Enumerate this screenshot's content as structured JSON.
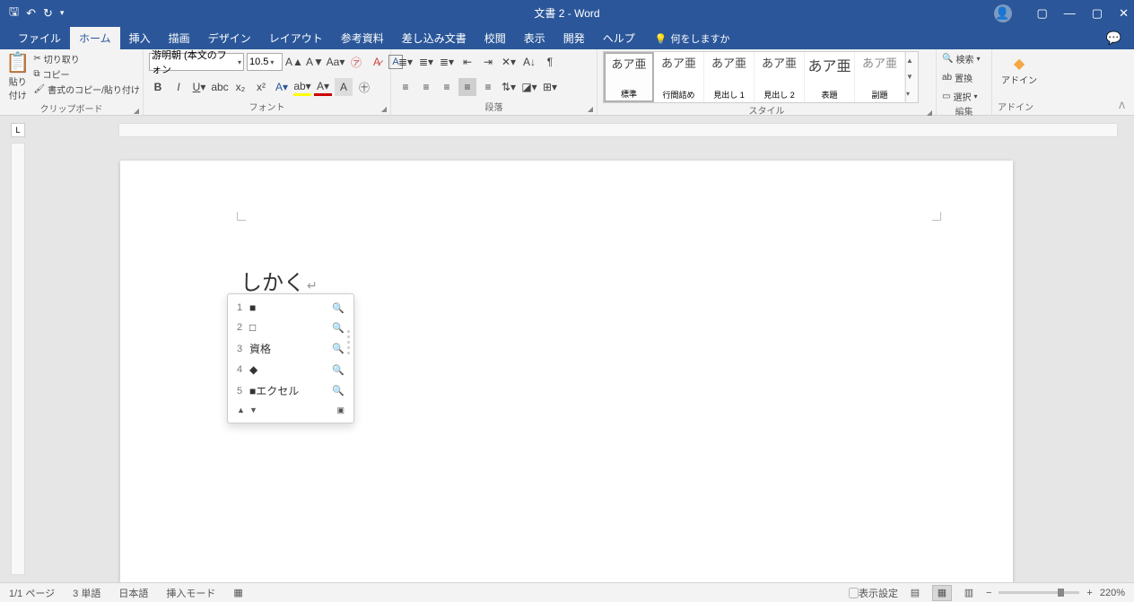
{
  "title": "文書 2 - Word",
  "tabs": {
    "file": "ファイル",
    "home": "ホーム",
    "insert": "挿入",
    "draw": "描画",
    "design": "デザイン",
    "layout": "レイアウト",
    "references": "参考資料",
    "mailings": "差し込み文書",
    "review": "校閲",
    "view": "表示",
    "developer": "開発",
    "help": "ヘルプ",
    "tell": "何をしますか"
  },
  "clipboard": {
    "paste": "貼り付け",
    "cut": "切り取り",
    "copy": "コピー",
    "format_painter": "書式のコピー/貼り付け",
    "label": "クリップボード"
  },
  "font": {
    "name": "游明朝 (本文のフォン",
    "size": "10.5",
    "label": "フォント"
  },
  "paragraph": {
    "label": "段落"
  },
  "styles": {
    "label": "スタイル",
    "preview": "あア亜",
    "items": [
      "標準",
      "行間詰め",
      "見出し 1",
      "見出し 2",
      "表題",
      "副題"
    ]
  },
  "editing": {
    "find": "検索",
    "replace": "置換",
    "select": "選択",
    "label": "編集"
  },
  "addins": {
    "label": "アドイン",
    "btn": "アドイン"
  },
  "document": {
    "text": "しかく"
  },
  "ime": {
    "candidates": [
      {
        "n": "1",
        "text": "■"
      },
      {
        "n": "2",
        "text": "□"
      },
      {
        "n": "3",
        "text": "資格"
      },
      {
        "n": "4",
        "text": "◆"
      },
      {
        "n": "5",
        "text": "■エクセル"
      }
    ]
  },
  "status": {
    "page": "1/1 ページ",
    "words": "3 単語",
    "lang": "日本語",
    "mode": "挿入モード",
    "display": "表示設定",
    "zoom": "220%"
  }
}
